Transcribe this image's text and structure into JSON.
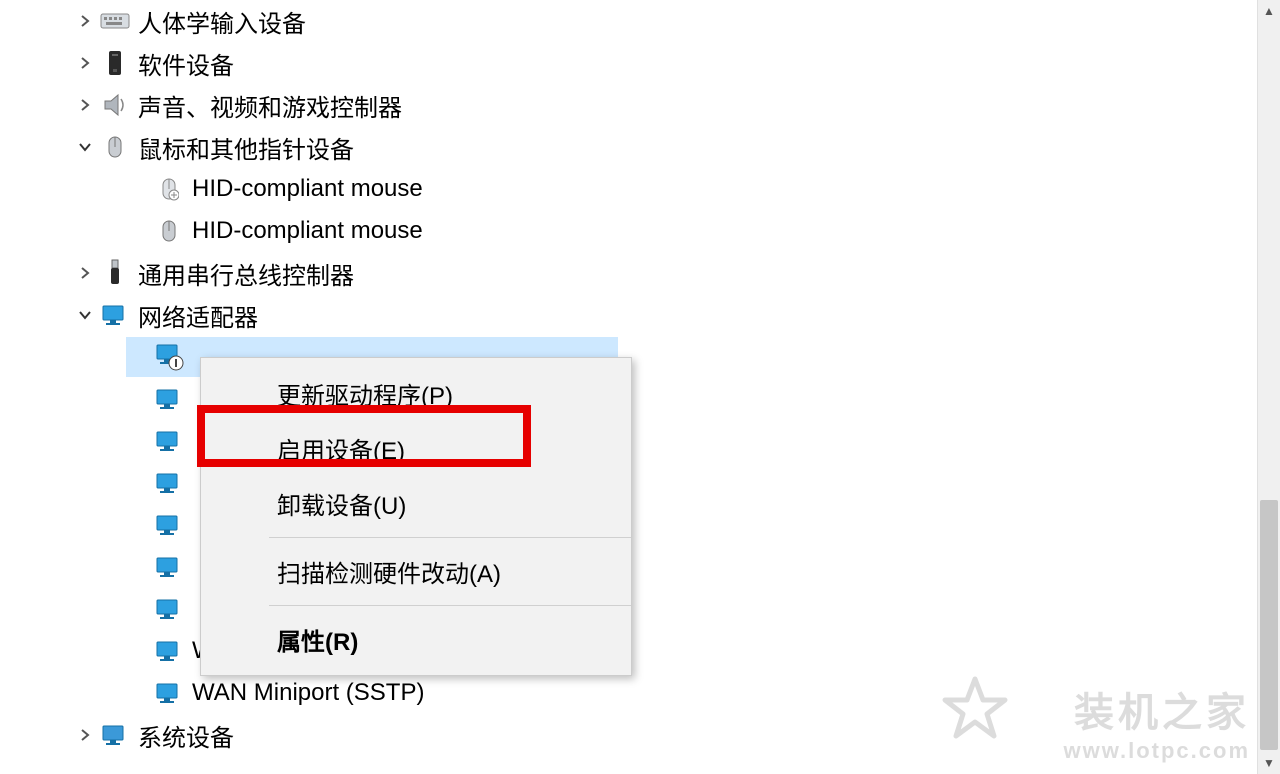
{
  "tree": {
    "hid_devices": "人体学输入设备",
    "software_devices": "软件设备",
    "sound_video_game": "声音、视频和游戏控制器",
    "mice_pointing": "鼠标和其他指针设备",
    "hid_mouse": "HID-compliant mouse",
    "usb_controllers": "通用串行总线控制器",
    "network_adapters": "网络适配器",
    "wan_pptp": "WAN Miniport (PPTP)",
    "wan_sstp": "WAN Miniport (SSTP)",
    "system_devices": "系统设备"
  },
  "context_menu": {
    "update_driver": "更新驱动程序(P)",
    "enable_device": "启用设备(E)",
    "uninstall_device": "卸载设备(U)",
    "scan_hardware": "扫描检测硬件改动(A)",
    "properties": "属性(R)"
  },
  "watermark": {
    "title": "装机之家",
    "url": "www.lotpc.com"
  }
}
